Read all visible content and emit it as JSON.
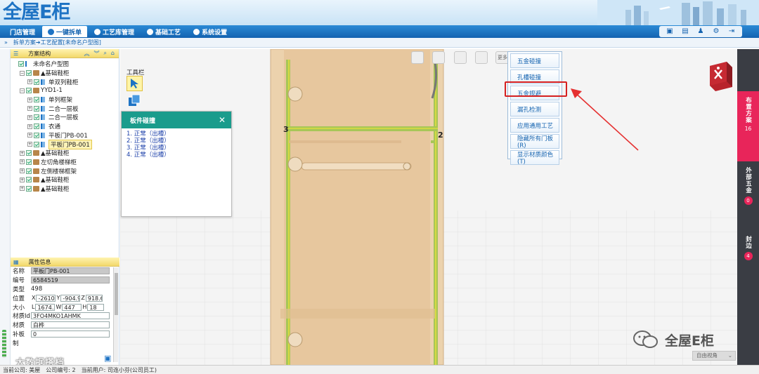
{
  "header": {
    "logo_text": "全屋E柜"
  },
  "nav": {
    "items": [
      {
        "label": "门店管理",
        "active": false
      },
      {
        "label": "一键拆单",
        "active": true
      },
      {
        "label": "工艺库管理",
        "active": false
      },
      {
        "label": "基础工艺",
        "active": false
      },
      {
        "label": "系统设置",
        "active": false
      }
    ]
  },
  "breadcrumb": {
    "text": "拆单方案➔工艺配置[未命名户型图]"
  },
  "scheme_panel": {
    "title": "方案结构",
    "tree": [
      {
        "label": "未命名户型图",
        "level": 0,
        "icon": "root-flag-icon",
        "exp": ""
      },
      {
        "label": "▲基础鞋柜",
        "level": 1,
        "icon": "cabinet-icon",
        "exp": "−"
      },
      {
        "label": "单双列鞋柜",
        "level": 2,
        "icon": "flag-icon",
        "exp": "+"
      },
      {
        "label": "YYD1-1",
        "level": 1,
        "icon": "cabinet-icon",
        "exp": "−"
      },
      {
        "label": "单列框架",
        "level": 2,
        "icon": "flag-icon",
        "exp": "+"
      },
      {
        "label": "二合一层板",
        "level": 2,
        "icon": "flag-icon",
        "exp": "+"
      },
      {
        "label": "二合一层板",
        "level": 2,
        "icon": "flag-icon",
        "exp": "+"
      },
      {
        "label": "衣通",
        "level": 2,
        "icon": "flag-icon",
        "exp": "+"
      },
      {
        "label": "平板门PB-001",
        "level": 2,
        "icon": "flag-icon",
        "exp": "+"
      },
      {
        "label": "平板门PB-001",
        "level": 2,
        "icon": "flag-icon",
        "exp": "+",
        "selected": true
      },
      {
        "label": "▲基础鞋柜",
        "level": 1,
        "icon": "cabinet-icon",
        "exp": "+"
      },
      {
        "label": "左切角楼梯柜",
        "level": 1,
        "icon": "cabinet-icon",
        "exp": "+"
      },
      {
        "label": "左侧楼梯框架",
        "level": 1,
        "icon": "cabinet-icon",
        "exp": "+"
      },
      {
        "label": "▲基础鞋柜",
        "level": 1,
        "icon": "cabinet-icon",
        "exp": "+"
      },
      {
        "label": "▲基础鞋柜",
        "level": 1,
        "icon": "cabinet-icon",
        "exp": "+"
      }
    ]
  },
  "props_panel": {
    "title": "属性信息",
    "name_label": "名称",
    "name_value": "平板门PB-001",
    "code_label": "编号",
    "code_value": "6584519",
    "type_label": "类型",
    "type_value": "498",
    "pos_label": "位置",
    "pos_x_label": "X",
    "pos_x": "-2610.",
    "pos_y_label": "Y",
    "pos_y": "-904.9",
    "pos_z_label": "Z",
    "pos_z": "918.67",
    "size_label": "大小",
    "size_l_label": "L",
    "size_l": "1674.3",
    "size_w_label": "W",
    "size_w": "447",
    "size_h_label": "H",
    "size_h": "18",
    "material_id_label": "材质Id",
    "material_id_value": "3FO4MKO1AHMK",
    "material_label": "材质",
    "material_value": "白桦",
    "patch_label": "补板",
    "patch_value": "0",
    "hidden_label": "制"
  },
  "toolbox": {
    "label": "工具栏"
  },
  "dialog": {
    "title": "板件碰撞",
    "items": [
      "1. 正常（出槽）",
      "2. 正常（出槽）",
      "3. 正常（出槽）",
      "4. 正常（出槽）"
    ],
    "close": "✕"
  },
  "viewport": {
    "more_label": "更多",
    "dim_left": "3",
    "dim_right": "2",
    "view_select": "自由视角",
    "watermark": "全屋E柜",
    "bottom_watermark": "大数据搭档"
  },
  "menu": {
    "items": [
      "五金碰撞",
      "孔槽碰撞",
      "五金规避",
      "漏孔检测",
      "应用通用工艺",
      "隐藏所有门板(R)",
      "显示材质颜色(T)"
    ],
    "highlighted_index": 2
  },
  "right_tabs": [
    {
      "label": "布置方案",
      "count": "16",
      "color": "#e8255a"
    },
    {
      "label": "外部五金",
      "count": "0",
      "color": "#3a3d44"
    },
    {
      "label": "封边",
      "count": "4",
      "color": "#3a3d44"
    }
  ],
  "statusbar": {
    "company_label": "当前公司: 美屋",
    "company_no_label": "公司编号: 2",
    "user_label": "当前用户: 司连小芬(公司员工)"
  },
  "colors": {
    "nav_blue": "#1463b0",
    "dialog_teal": "#1a9c8c",
    "highlight_red": "#d62020",
    "cabinet_wood": "#e8c9a0",
    "panel_edge_green": "#9ac24a"
  }
}
